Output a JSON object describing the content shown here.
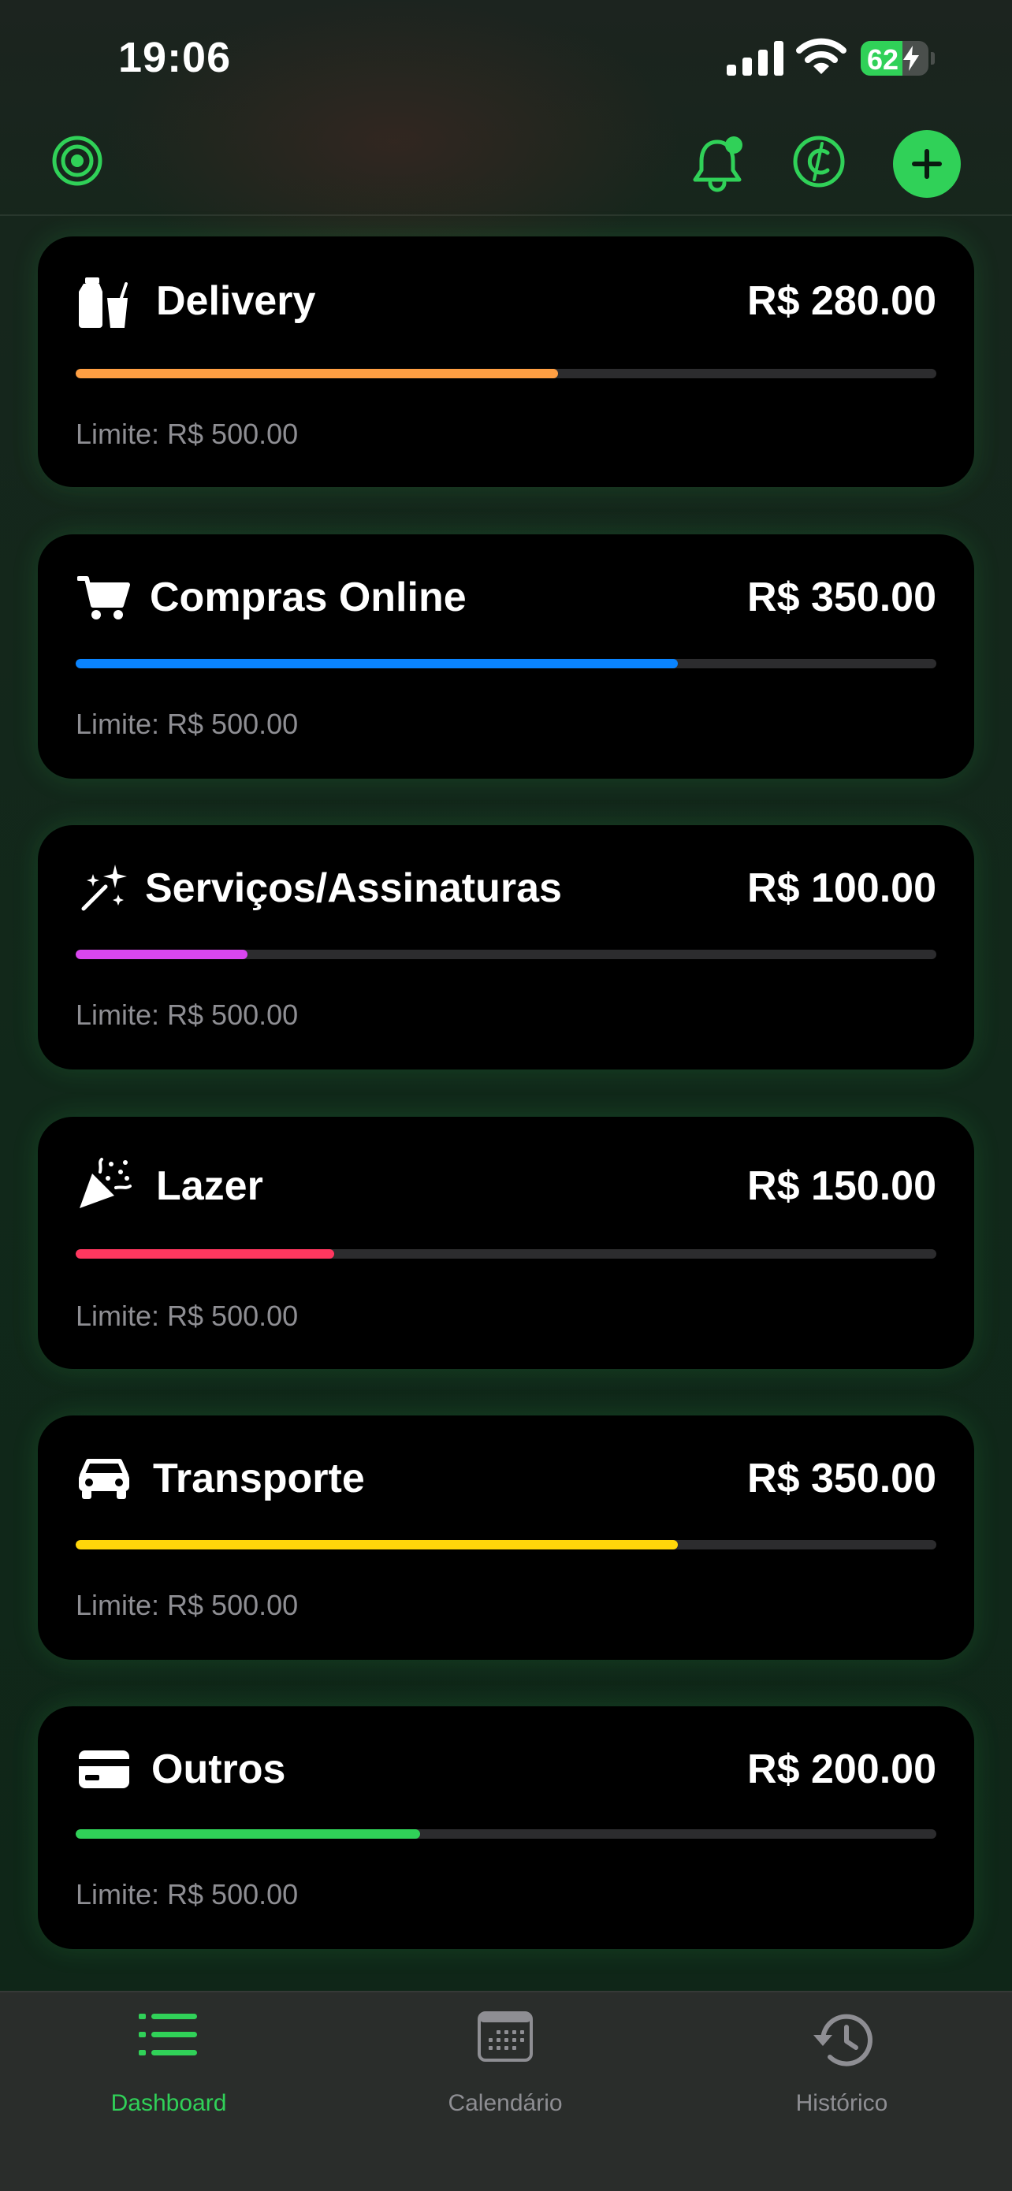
{
  "status_bar": {
    "time": "19:06",
    "battery_percent": 62,
    "battery_label": "62"
  },
  "colors": {
    "accent": "#30d158",
    "inactive": "#8e8e93"
  },
  "header": {
    "left_icon": "target-icon",
    "right_icons": [
      "bell-badge-icon",
      "currency-icon",
      "plus-icon"
    ]
  },
  "categories": [
    {
      "icon": "bag-cup-icon",
      "name": "Delivery",
      "amount": "R$ 280.00",
      "limit_label": "Limite: R$ 500.00",
      "progress": 0.56,
      "color": "#ff9f43"
    },
    {
      "icon": "cart-icon",
      "name": "Compras Online",
      "amount": "R$ 350.00",
      "limit_label": "Limite: R$ 500.00",
      "progress": 0.7,
      "color": "#0a84ff"
    },
    {
      "icon": "sparkles-wand-icon",
      "name": "Serviços/Assinaturas",
      "amount": "R$ 100.00",
      "limit_label": "Limite: R$ 500.00",
      "progress": 0.2,
      "color": "#d946ef"
    },
    {
      "icon": "party-popper-icon",
      "name": "Lazer",
      "amount": "R$ 150.00",
      "limit_label": "Limite: R$ 500.00",
      "progress": 0.3,
      "color": "#ff375f"
    },
    {
      "icon": "car-icon",
      "name": "Transporte",
      "amount": "R$ 350.00",
      "limit_label": "Limite: R$ 500.00",
      "progress": 0.7,
      "color": "#ffd60a"
    },
    {
      "icon": "credit-card-icon",
      "name": "Outros",
      "amount": "R$ 200.00",
      "limit_label": "Limite: R$ 500.00",
      "progress": 0.4,
      "color": "#30d158"
    }
  ],
  "tabs": [
    {
      "label": "Dashboard",
      "icon": "list-bullet-icon",
      "active": true
    },
    {
      "label": "Calendário",
      "icon": "calendar-icon",
      "active": false
    },
    {
      "label": "Histórico",
      "icon": "clock-history-icon",
      "active": false
    }
  ]
}
